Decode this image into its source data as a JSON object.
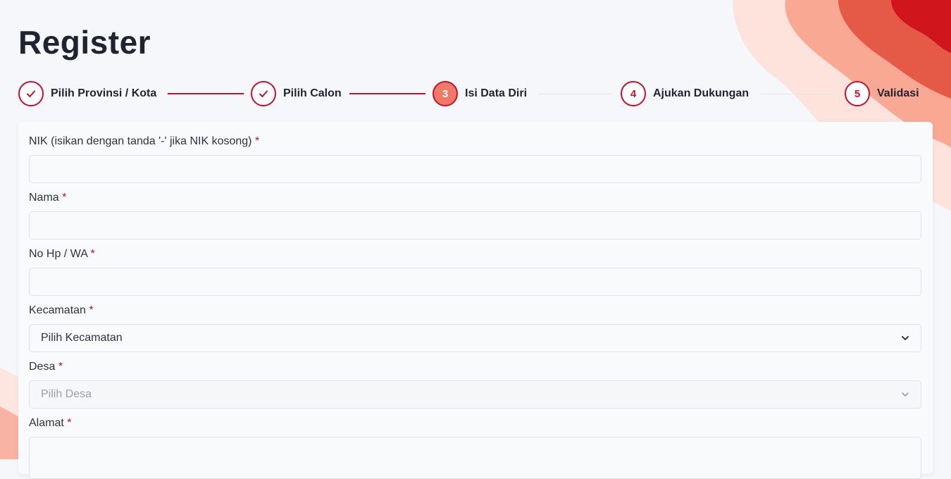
{
  "page": {
    "title": "Register"
  },
  "stepper": {
    "steps": [
      {
        "number": "",
        "label": "Pilih Provinsi / Kota",
        "state": "done",
        "icon": "check-icon"
      },
      {
        "number": "",
        "label": "Pilih Calon",
        "state": "done",
        "icon": "check-icon"
      },
      {
        "number": "3",
        "label": "Isi Data Diri",
        "state": "active"
      },
      {
        "number": "4",
        "label": "Ajukan Dukungan",
        "state": "todo"
      },
      {
        "number": "5",
        "label": "Validasi",
        "state": "todo"
      }
    ]
  },
  "form": {
    "required_mark": "*",
    "nik": {
      "label": "NIK (isikan dengan tanda '-' jika NIK kosong)",
      "value": ""
    },
    "nama": {
      "label": "Nama",
      "value": ""
    },
    "hp": {
      "label": "No Hp / WA",
      "value": ""
    },
    "kecamatan": {
      "label": "Kecamatan",
      "selected": "Pilih Kecamatan"
    },
    "desa": {
      "label": "Desa",
      "selected": "Pilih Desa"
    },
    "alamat": {
      "label": "Alamat",
      "value": ""
    }
  },
  "colors": {
    "accent": "#c8102e",
    "active_step": "#f07a6a",
    "background": "#f5f7fa"
  }
}
